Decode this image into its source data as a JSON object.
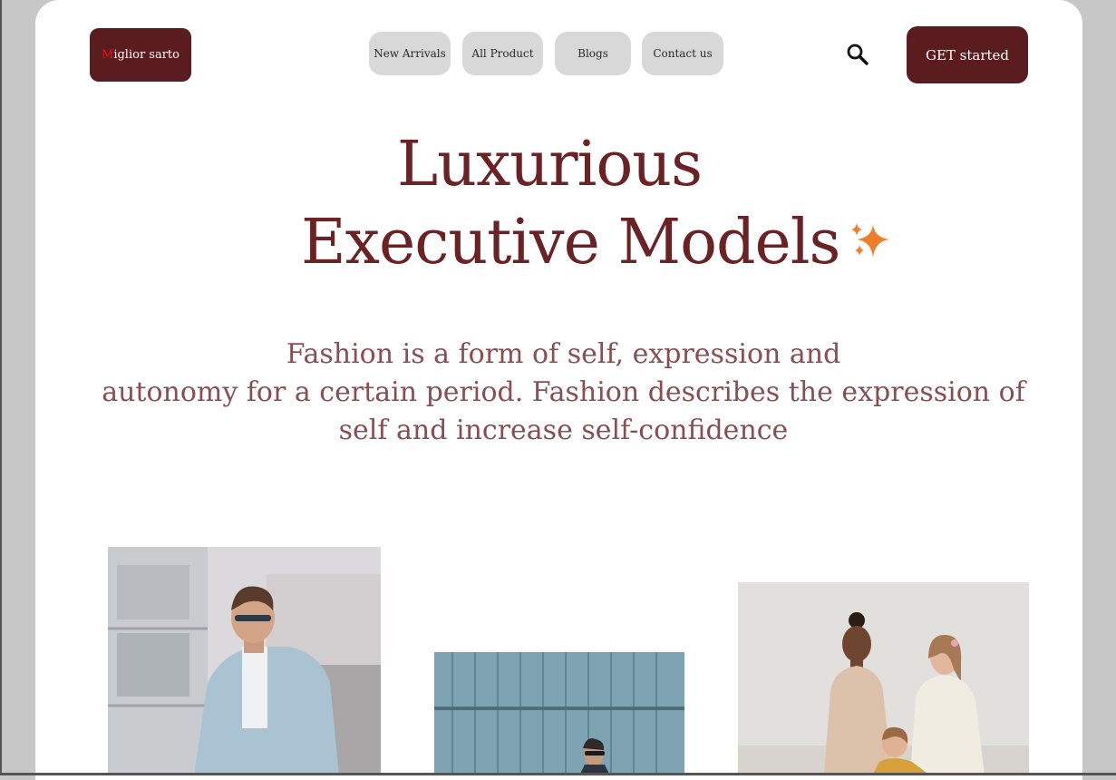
{
  "header": {
    "logo_first_letter": "M",
    "logo_rest": "iglior sarto",
    "nav": [
      "New Arrivals",
      "All Product",
      "Blogs",
      "Contact us"
    ],
    "search_icon": "search-icon",
    "cta_label": "GET started"
  },
  "hero": {
    "title_line1": "Luxurious",
    "title_line2": "Executive Models",
    "sparkle_icon": "sparkle-icon",
    "description_lines": [
      "Fashion is a form of self, expression and",
      "autonomy for a certain period. Fashion describes the expression of",
      "self and increase self-confidence"
    ]
  },
  "gallery": {
    "photos": [
      "man-blue-jacket-photo",
      "man-blue-wall-photo",
      "women-coats-photo"
    ]
  },
  "colors": {
    "brand": "#5a1c1f",
    "title": "#6b2224",
    "description": "#8a4e52",
    "nav_bg": "#d8d8d8",
    "sparkle": "#f07d2a"
  }
}
